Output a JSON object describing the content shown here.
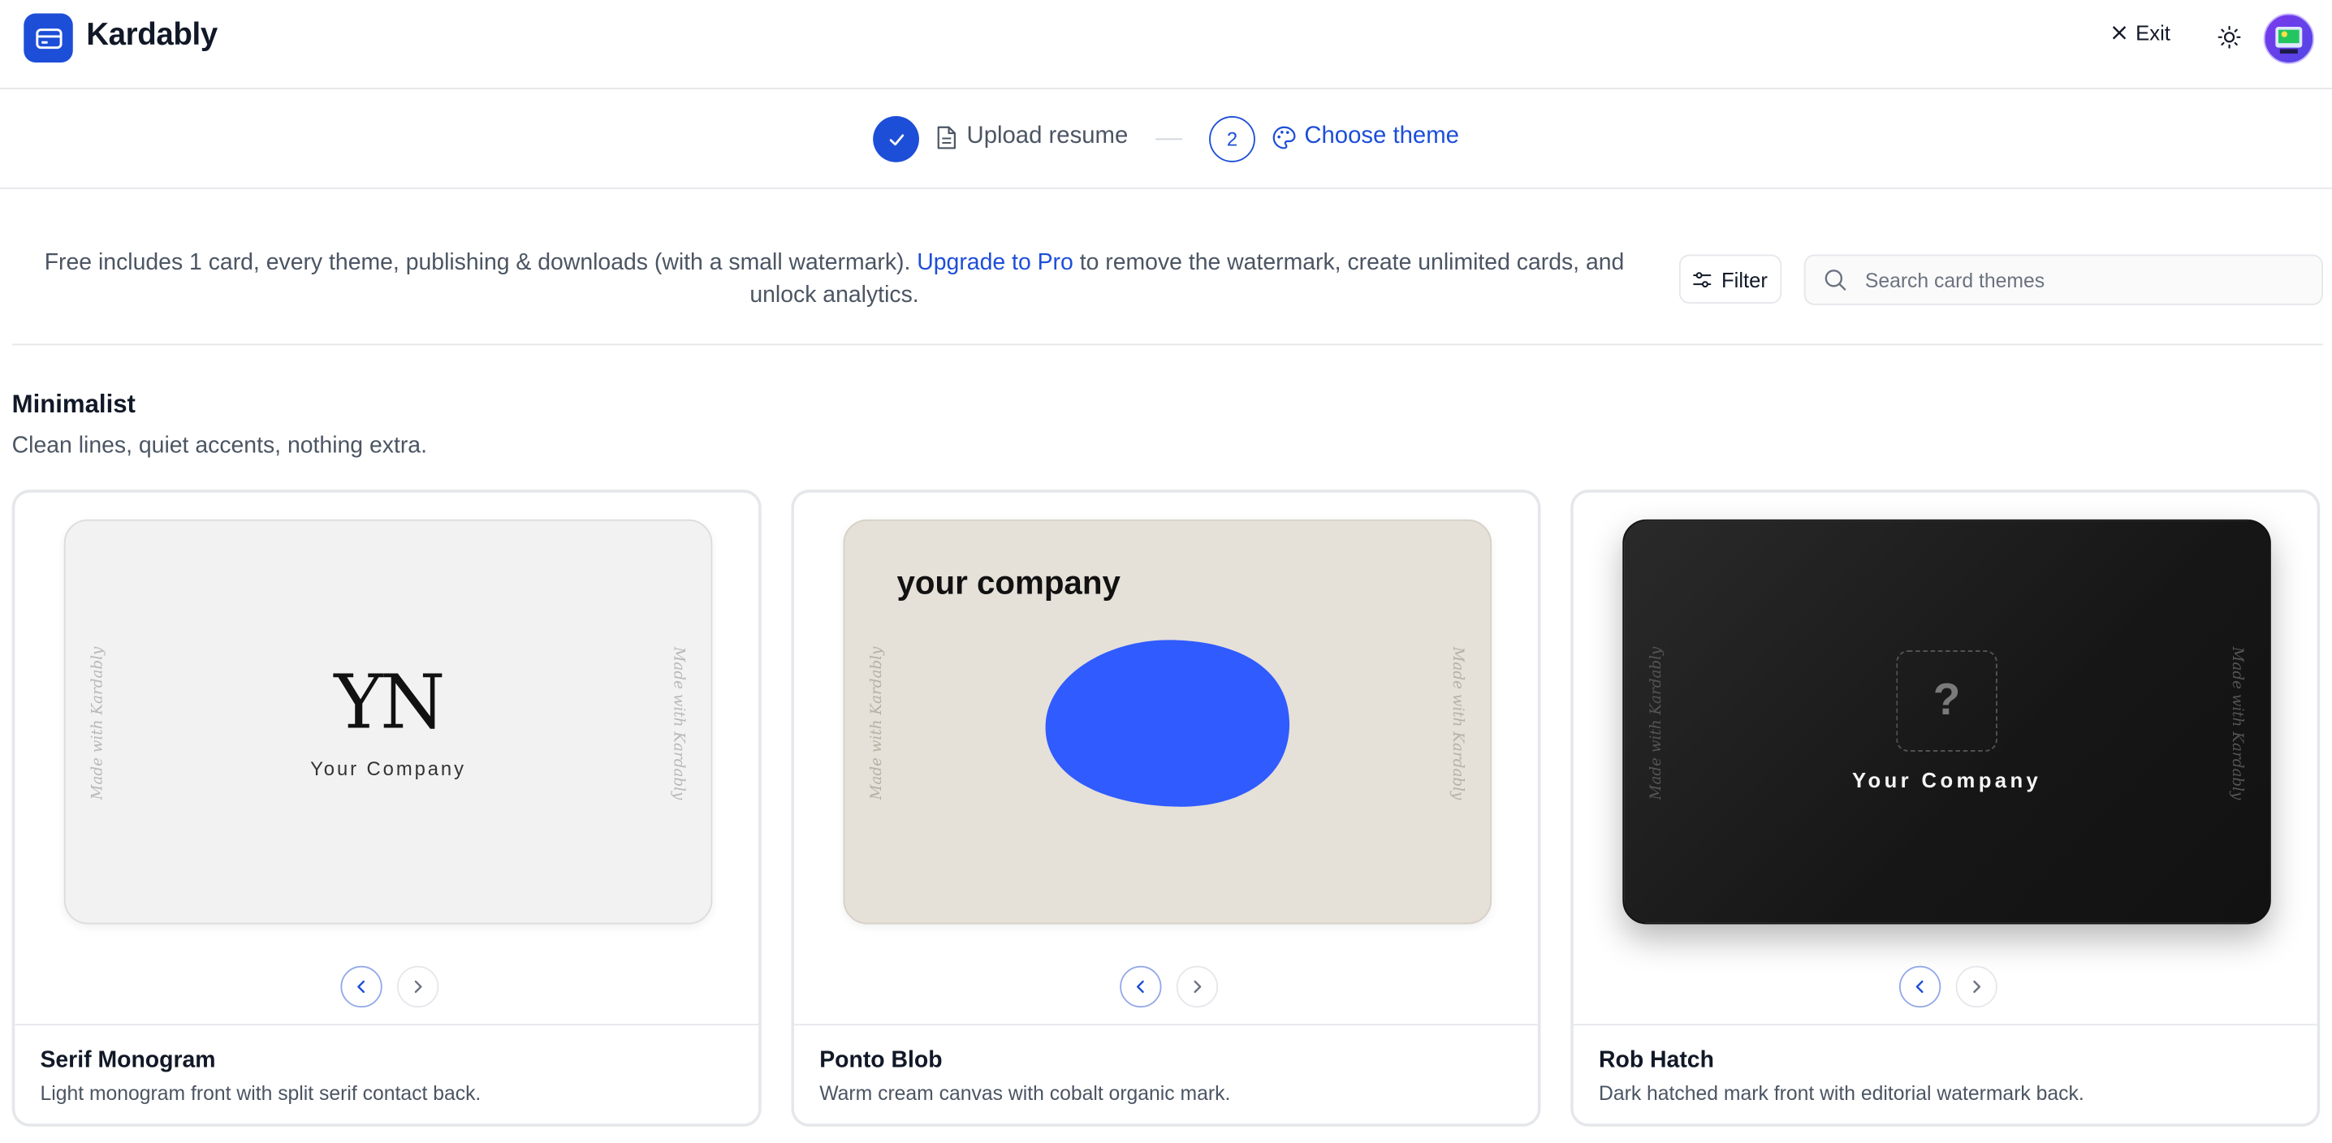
{
  "app": {
    "name": "Kardably"
  },
  "header": {
    "exit_label": "Exit"
  },
  "stepper": {
    "steps": [
      {
        "label": "Upload resume",
        "state": "complete"
      },
      {
        "number": "2",
        "label": "Choose theme",
        "state": "current"
      }
    ]
  },
  "info": {
    "text_before": "Free includes 1 card, every theme, publishing & downloads (with a small watermark). ",
    "link_label": "Upgrade to Pro",
    "text_after": " to remove the watermark, create unlimited cards, and unlock analytics."
  },
  "toolbar": {
    "filter_label": "Filter",
    "search_placeholder": "Search card themes",
    "search_value": ""
  },
  "section": {
    "title": "Minimalist",
    "subtitle": "Clean lines, quiet accents, nothing extra."
  },
  "watermark_text": "Made with Kardably",
  "themes": [
    {
      "name": "Serif Monogram",
      "description": "Light monogram front with split serif contact back.",
      "monogram": "YN",
      "company": "Your Company"
    },
    {
      "name": "Ponto Blob",
      "description": "Warm cream canvas with cobalt organic mark.",
      "company": "your company",
      "accent": "#2f5bff"
    },
    {
      "name": "Rob Hatch",
      "description": "Dark hatched mark front with editorial watermark back.",
      "placeholder_glyph": "?",
      "company": "Your Company"
    }
  ],
  "colors": {
    "accent": "#1d4ed8",
    "border": "#e5e7eb",
    "muted_text": "#4b5563"
  }
}
